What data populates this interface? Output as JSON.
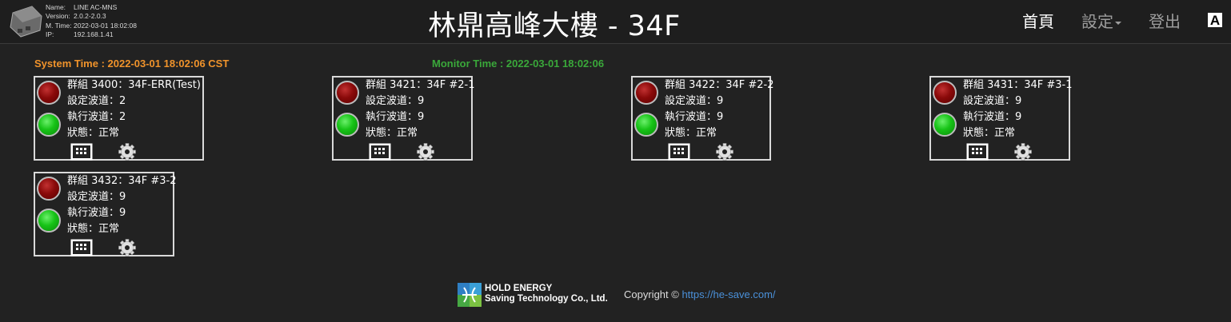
{
  "device": {
    "name_label": "Name:",
    "name": "LINE AC-MNS",
    "version_label": "Version:",
    "version": "2.0.2-2.0.3",
    "mtime_label": "M. Time:",
    "mtime": "2022-03-01 18:02:08",
    "ip_label": "IP:",
    "ip": "192.168.1.41"
  },
  "header": {
    "title": "林鼎高峰大樓 - 34F",
    "nav_home": "首頁",
    "nav_settings": "設定",
    "nav_logout": "登出",
    "font_toggle": "A"
  },
  "times": {
    "system": "System Time : 2022-03-01 18:02:06 CST",
    "monitor": "Monitor Time : 2022-03-01 18:02:06"
  },
  "groups": [
    {
      "title": "群組 3400：34F-ERR(Test)",
      "set_channel": "設定波道：2",
      "run_channel": "執行波道：2",
      "status": "狀態：正常"
    },
    {
      "title": "群組 3421：34F #2-1",
      "set_channel": "設定波道：9",
      "run_channel": "執行波道：9",
      "status": "狀態：正常"
    },
    {
      "title": "群組 3422：34F #2-2",
      "set_channel": "設定波道：9",
      "run_channel": "執行波道：9",
      "status": "狀態：正常"
    },
    {
      "title": "群組 3431：34F #3-1",
      "set_channel": "設定波道：9",
      "run_channel": "執行波道：9",
      "status": "狀態：正常"
    },
    {
      "title": "群組 3432：34F #3-2",
      "set_channel": "設定波道：9",
      "run_channel": "執行波道：9",
      "status": "狀態：正常"
    }
  ],
  "icons": {
    "led_top": "red-led-icon",
    "led_bottom": "green-led-icon",
    "keypad": "keypad-icon",
    "settings": "gear-icon"
  },
  "colors": {
    "system_time": "#f0932b",
    "monitor_time": "#3aa83a",
    "link": "#4a90d9",
    "background": "#222222"
  },
  "footer": {
    "company_line1": "HOLD ENERGY",
    "company_line2": "Saving Technology Co., Ltd.",
    "copyright": "Copyright ©",
    "link_text": "https://he-save.com/"
  }
}
